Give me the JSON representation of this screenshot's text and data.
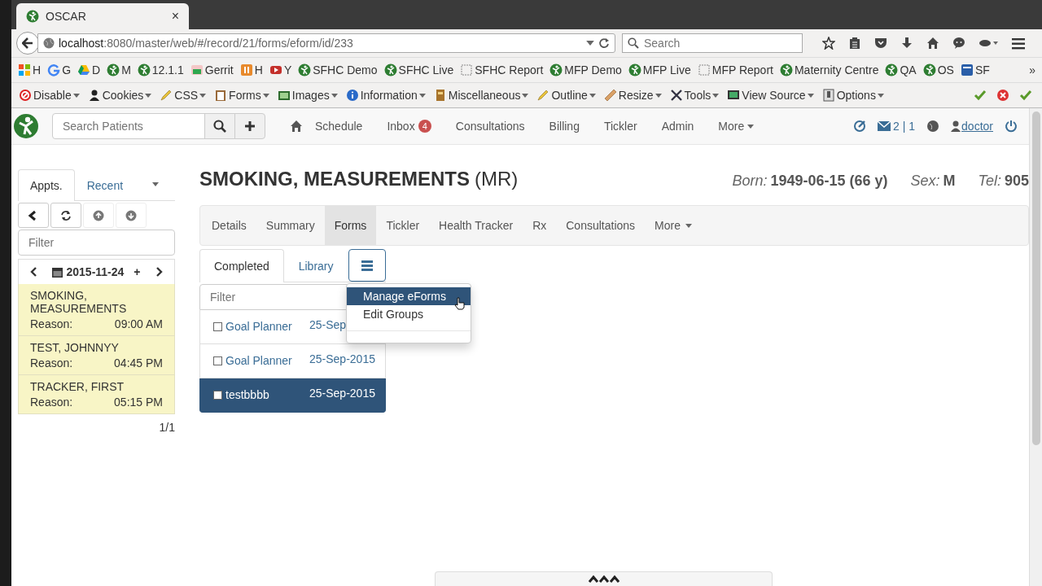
{
  "browser": {
    "tab_title": "OSCAR",
    "tab_close": "×",
    "url_host": "localhost",
    "url_path": ":8080/master/web/#/record/21/forms/eform/id/233",
    "search_placeholder": "Search"
  },
  "bookmarks": [
    {
      "label": "H",
      "kind": "windows"
    },
    {
      "label": "G",
      "kind": "google"
    },
    {
      "label": "D",
      "kind": "drive"
    },
    {
      "label": "M",
      "kind": "oscar"
    },
    {
      "label": "12.1.1",
      "kind": "oscar"
    },
    {
      "label": "Gerrit",
      "kind": "gerrit"
    },
    {
      "label": "H",
      "kind": "orange"
    },
    {
      "label": "Y",
      "kind": "video"
    },
    {
      "label": "SFHC Demo",
      "kind": "oscar"
    },
    {
      "label": "SFHC Live",
      "kind": "oscar"
    },
    {
      "label": "SFHC Report",
      "kind": "blank"
    },
    {
      "label": "MFP Demo",
      "kind": "oscar"
    },
    {
      "label": "MFP Live",
      "kind": "oscar"
    },
    {
      "label": "MFP Report",
      "kind": "blank"
    },
    {
      "label": "Maternity Centre",
      "kind": "oscar"
    },
    {
      "label": "QA",
      "kind": "oscar"
    },
    {
      "label": "OS",
      "kind": "oscar"
    },
    {
      "label": "SF",
      "kind": "blue"
    }
  ],
  "bookmarks_more": "»",
  "devtools": [
    {
      "label": "Disable",
      "kind": "block"
    },
    {
      "label": "Cookies",
      "kind": "person"
    },
    {
      "label": "CSS",
      "kind": "pencil"
    },
    {
      "label": "Forms",
      "kind": "clipboard"
    },
    {
      "label": "Images",
      "kind": "image"
    },
    {
      "label": "Information",
      "kind": "info"
    },
    {
      "label": "Miscellaneous",
      "kind": "book"
    },
    {
      "label": "Outline",
      "kind": "pencil"
    },
    {
      "label": "Resize",
      "kind": "ruler"
    },
    {
      "label": "Tools",
      "kind": "tools"
    },
    {
      "label": "View Source",
      "kind": "monitor"
    },
    {
      "label": "Options",
      "kind": "panel"
    }
  ],
  "app": {
    "search_placeholder": "Search Patients",
    "nav": [
      {
        "label": "Schedule"
      },
      {
        "label": "Inbox",
        "badge": "4"
      },
      {
        "label": "Consultations"
      },
      {
        "label": "Billing"
      },
      {
        "label": "Tickler"
      },
      {
        "label": "Admin"
      },
      {
        "label": "More",
        "menu": true
      }
    ],
    "messages": "2 | 1",
    "user": "doctor"
  },
  "sidebar": {
    "tabs": [
      {
        "label": "Appts.",
        "selected": true
      },
      {
        "label": "Recent",
        "selected": false
      }
    ],
    "filter_placeholder": "Filter",
    "date": "2015-11-24",
    "date_add": "+",
    "appointments": [
      {
        "name": "SMOKING, MEASUREMENTS",
        "reason_label": "Reason:",
        "time": "09:00 AM"
      },
      {
        "name": "TEST, JOHNNYY",
        "reason_label": "Reason:",
        "time": "04:45 PM"
      },
      {
        "name": "TRACKER, FIRST",
        "reason_label": "Reason:",
        "time": "05:15 PM"
      }
    ],
    "pager": "1/1"
  },
  "patient": {
    "name": "SMOKING, MEASUREMENTS",
    "title": "(MR)",
    "born_label": "Born:",
    "born": "1949-06-15",
    "age": "(66 y)",
    "sex_label": "Sex:",
    "sex": "M",
    "tel_label": "Tel:",
    "tel": "905"
  },
  "record_tabs": [
    {
      "label": "Details",
      "selected": false
    },
    {
      "label": "Summary",
      "selected": false
    },
    {
      "label": "Forms",
      "selected": true
    },
    {
      "label": "Tickler",
      "selected": false
    },
    {
      "label": "Health Tracker",
      "selected": false
    },
    {
      "label": "Rx",
      "selected": false
    },
    {
      "label": "Consultations",
      "selected": false
    },
    {
      "label": "More",
      "selected": false,
      "menu": true
    }
  ],
  "form_tabs": [
    {
      "label": "Completed",
      "selected": true
    },
    {
      "label": "Library",
      "selected": false
    }
  ],
  "groups_menu": {
    "open": true,
    "items": [
      {
        "label": "Manage eForms",
        "selected": true
      },
      {
        "label": "Edit Groups",
        "selected": false
      }
    ]
  },
  "forms": {
    "filter_placeholder": "Filter",
    "rows": [
      {
        "name": "Goal Planner",
        "date": "25-Sep",
        "checked": false,
        "selected": false
      },
      {
        "name": "Goal Planner",
        "date": "25-Sep-2015",
        "checked": false,
        "selected": false
      },
      {
        "name": "testbbbb",
        "date": "25-Sep-2015",
        "checked": false,
        "selected": true
      }
    ]
  }
}
